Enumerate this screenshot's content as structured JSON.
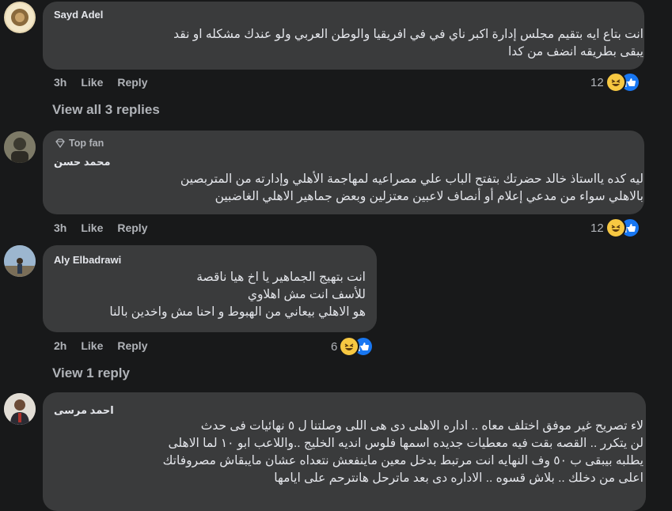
{
  "comments": [
    {
      "author": "Sayd Adel",
      "text": "انت بتاع ايه بتقيم مجلس إدارة اكبر ناي في في افريقيا والوطن العربي ولو عندك مشكله او نقد\nيبقى بطريقه انضف من كدا",
      "time": "3h",
      "like_label": "Like",
      "reply_label": "Reply",
      "reaction_count": "12",
      "reaction_icons": [
        "haha-icon",
        "like-icon"
      ],
      "view_replies": "View all 3 replies"
    },
    {
      "badge": "Top fan",
      "author": "محمد حسن",
      "text": "ليه كده يااستاذ خالد حضرتك بتفتح الباب علي مصراعيه لمهاجمة الأهلي وإدارته من المتربصين\nبالاهلي سواء من مدعي إعلام أو أنصاف لاعبين معتزلين وبعض جماهير الاهلي الغاضبين",
      "time": "3h",
      "like_label": "Like",
      "reply_label": "Reply",
      "reaction_count": "12",
      "reaction_icons": [
        "haha-icon",
        "like-icon"
      ]
    },
    {
      "author": "Aly Elbadrawi",
      "text": "انت بتهيج الجماهير يا اخ هيا ناقصة\nللأسف انت مش اهلاوي\nهو الاهلي بيعاني من الهبوط و احنا مش واخدين بالنا",
      "time": "2h",
      "like_label": "Like",
      "reply_label": "Reply",
      "reaction_count": "6",
      "reaction_icons": [
        "haha-icon",
        "like-icon"
      ],
      "view_replies": "View 1 reply"
    },
    {
      "author": "احمد مرسى",
      "text": "لاء تصريح غير موفق اختلف معاه .. اداره الاهلى دى هى اللى وصلتنا ل ٥ نهائيات فى حدث\nلن يتكرر .. القصه بقت فيه معطيات جديده اسمها فلوس انديه الخليج ..واللاعب ابو ١٠ لما الاهلى\nيطلبه بيبقى ب ٥٠ وف النهايه انت مرتبط بدخل معين ماينفعش نتعداه عشان مايبقاش مصروفاتك\nاعلى من دخلك .. بلاش قسوه .. الاداره دى بعد ماترحل هانترحم على ايامها"
    }
  ],
  "colors": {
    "background": "#18191a",
    "bubble": "#3a3b3c",
    "text": "#e4e6eb",
    "secondary": "#b0b3b8",
    "like_blue": "#1877f2",
    "haha_yellow": "#f7c842"
  }
}
